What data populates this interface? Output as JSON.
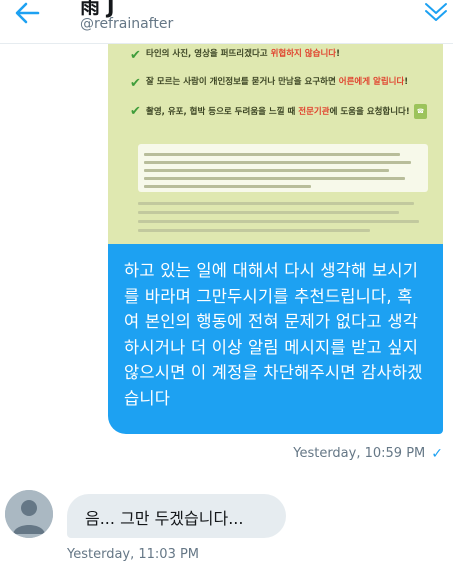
{
  "header": {
    "name": "雨 J",
    "handle": "@refrainafter",
    "back_icon": "arrow-left-icon",
    "chevron_icon": "chevron-down-icon"
  },
  "media": {
    "lines": [
      {
        "pre": "타인의 사진, 영상을 퍼뜨리겠다고 ",
        "hl": "위협하지 않습니다",
        "post": "!",
        "hl_color": "#e0442f"
      },
      {
        "pre": "잘 모르는 사람이 개인정보를 묻거나 만남을 요구하면 ",
        "hl": "어른에게 알립니다",
        "post": "!",
        "hl_color": "#e0442f"
      },
      {
        "pre": "촬영, 유포, 협박 등으로 두려움을 느낄 때 ",
        "hl": "전문기관",
        "post": "에 도움을 요청합니다!",
        "hl_color": "#e0442f"
      }
    ]
  },
  "messages": {
    "sent": {
      "text": "하고 있는 일에 대해서 다시 생각해 보시기를 바라며 그만두시기를 추천드립니다, 혹여 본인의 행동에 전혀 문제가 없다고 생각하시거나 더 이상 알림 메시지를 받고 싶지 않으시면 이 계정을 차단해주시면 감사하겠습니다",
      "timestamp": "Yesterday, 10:59 PM"
    },
    "received": {
      "text": "음... 그만 두겠습니다...",
      "timestamp": "Yesterday, 11:03 PM"
    }
  },
  "colors": {
    "accent": "#1da1f2",
    "received_bubble": "#e6ecf0",
    "meta_text": "#657786"
  }
}
